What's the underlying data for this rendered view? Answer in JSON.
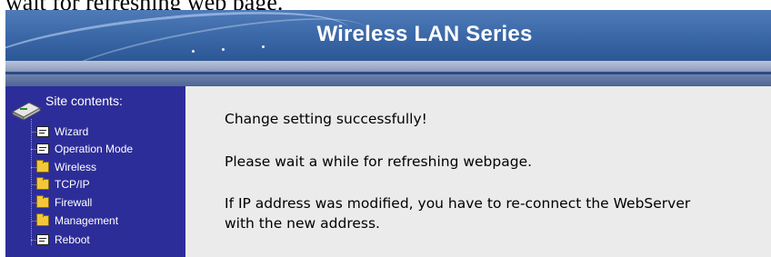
{
  "caption": "wait for refreshing web page.",
  "banner": {
    "title": "Wireless LAN Series"
  },
  "sidebar": {
    "title": "Site contents:",
    "items": [
      {
        "label": "Wizard",
        "icon": "page-icon"
      },
      {
        "label": "Operation Mode",
        "icon": "page-icon"
      },
      {
        "label": "Wireless",
        "icon": "folder-icon"
      },
      {
        "label": "TCP/IP",
        "icon": "folder-icon"
      },
      {
        "label": "Firewall",
        "icon": "folder-icon"
      },
      {
        "label": "Management",
        "icon": "folder-icon"
      },
      {
        "label": "Reboot",
        "icon": "page-icon"
      }
    ]
  },
  "content": {
    "line1": "Change setting successfully!",
    "line2": "Please wait a while for refreshing webpage.",
    "line3a": "If IP address was modified, you have to re-connect the WebServer",
    "line3b": "with the new address."
  },
  "colors": {
    "sidebar_bg": "#2d2d99",
    "banner_bg": "#3d6aa9",
    "content_bg": "#ebebeb"
  }
}
